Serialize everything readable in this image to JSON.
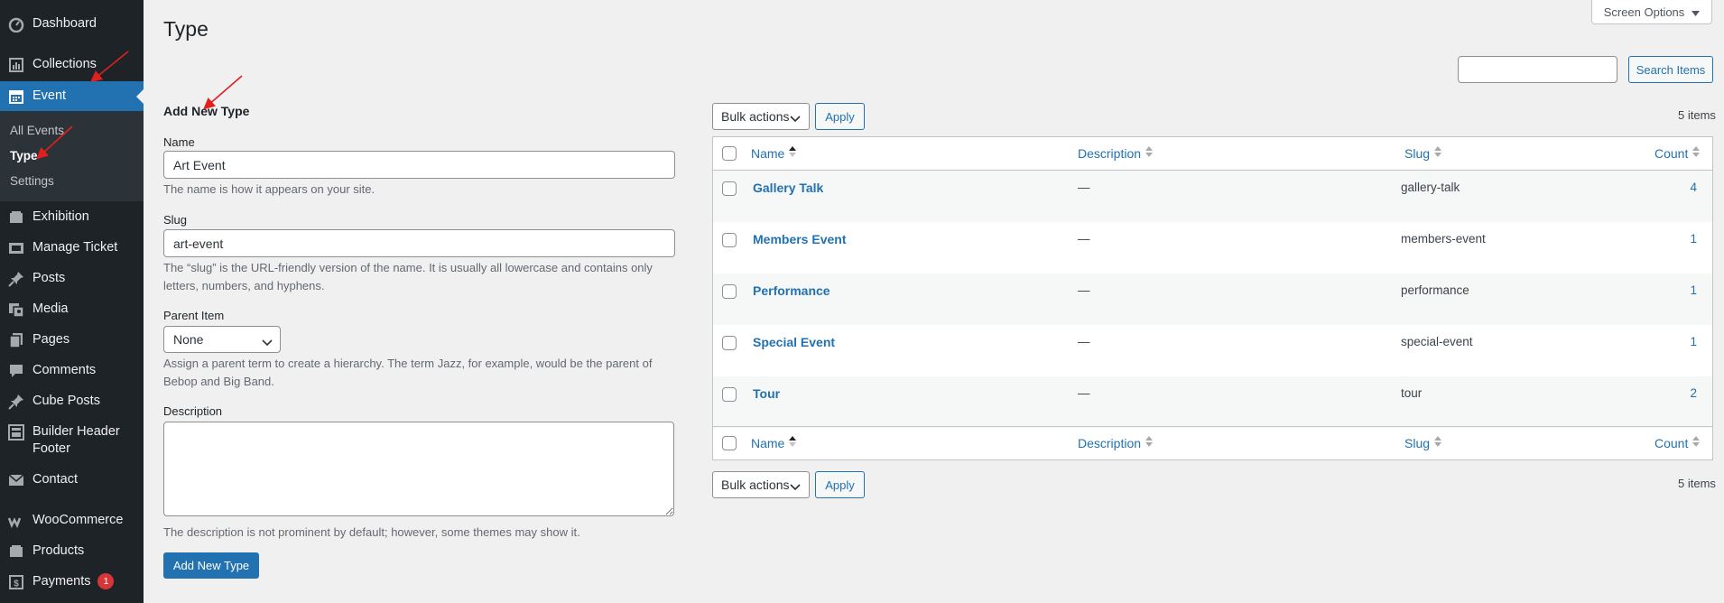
{
  "sidebar": {
    "items": [
      {
        "label": "Dashboard",
        "icon": "dashboard-icon"
      },
      {
        "label": "Collections",
        "icon": "collections-icon"
      },
      {
        "label": "Event",
        "icon": "calendar-icon"
      },
      {
        "label": "Exhibition",
        "icon": "exhibition-icon"
      },
      {
        "label": "Manage Ticket",
        "icon": "ticket-icon"
      },
      {
        "label": "Posts",
        "icon": "pin-icon"
      },
      {
        "label": "Media",
        "icon": "media-icon"
      },
      {
        "label": "Pages",
        "icon": "pages-icon"
      },
      {
        "label": "Comments",
        "icon": "comments-icon"
      },
      {
        "label": "Cube Posts",
        "icon": "pin-icon"
      },
      {
        "label": "Builder Header Footer",
        "icon": "builder-icon"
      },
      {
        "label": "Contact",
        "icon": "mail-icon"
      },
      {
        "label": "WooCommerce",
        "icon": "woocommerce-icon"
      },
      {
        "label": "Products",
        "icon": "products-icon"
      },
      {
        "label": "Payments",
        "icon": "payments-icon",
        "badge": "1"
      }
    ],
    "submenu": [
      {
        "label": "All Events"
      },
      {
        "label": "Type"
      },
      {
        "label": "Settings"
      }
    ]
  },
  "header": {
    "title": "Type",
    "screen_options": "Screen Options",
    "search_button": "Search Items",
    "search_value": ""
  },
  "form": {
    "heading": "Add New Type",
    "name_label": "Name",
    "name_value": "Art Event",
    "name_help": "The name is how it appears on your site.",
    "slug_label": "Slug",
    "slug_value": "art-event",
    "slug_help_1": "The “slug” is the URL-friendly version of the name. It is usually all lowercase and contains only",
    "slug_help_2": "letters, numbers, and hyphens.",
    "parent_label": "Parent Item",
    "parent_value": "None",
    "parent_help_1": "Assign a parent term to create a hierarchy. The term Jazz, for example, would be the parent of",
    "parent_help_2": "Bebop and Big Band.",
    "description_label": "Description",
    "description_value": "",
    "description_help": "The description is not prominent by default; however, some themes may show it.",
    "submit": "Add New Type"
  },
  "table": {
    "bulk_actions": "Bulk actions",
    "apply": "Apply",
    "items_count": "5 items",
    "columns": [
      "Name",
      "Description",
      "Slug",
      "Count"
    ],
    "rows": [
      {
        "name": "Gallery Talk",
        "description": "—",
        "slug": "gallery-talk",
        "count": "4"
      },
      {
        "name": "Members Event",
        "description": "—",
        "slug": "members-event",
        "count": "1"
      },
      {
        "name": "Performance",
        "description": "—",
        "slug": "performance",
        "count": "1"
      },
      {
        "name": "Special Event",
        "description": "—",
        "slug": "special-event",
        "count": "1"
      },
      {
        "name": "Tour",
        "description": "—",
        "slug": "tour",
        "count": "2"
      }
    ]
  },
  "colors": {
    "sidebar_bg": "#1d2327",
    "accent": "#2271b1",
    "annotation_arrow": "#e0201f"
  }
}
